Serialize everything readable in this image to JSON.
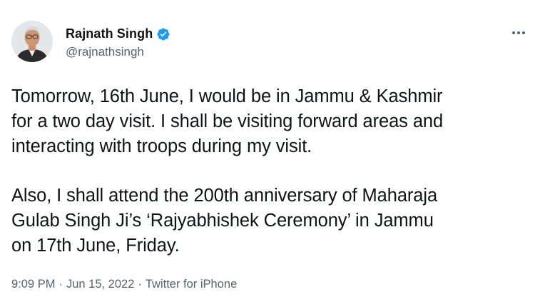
{
  "author": {
    "display_name": "Rajnath Singh",
    "handle": "@rajnathsingh",
    "verified": true
  },
  "tweet": {
    "paragraphs": [
      "Tomorrow, 16th June, I would be in Jammu & Kashmir\nfor a two day visit. I shall be visiting forward areas and\ninteracting with troops during my visit.",
      "Also, I shall attend the 200th anniversary of Maharaja\nGulab Singh Ji’s  ‘Rajyabhishek Ceremony’ in Jammu\non 17th June, Friday."
    ]
  },
  "meta": {
    "time": "9:09 PM",
    "separator_1": "·",
    "date": "Jun 15, 2022",
    "separator_2": "·",
    "source": "Twitter for iPhone"
  },
  "icons": {
    "verified": "verified-badge-icon",
    "more": "more-options-icon"
  },
  "colors": {
    "text_primary": "#0f1419",
    "text_secondary": "#536471",
    "verified_blue": "#1d9bf0"
  }
}
